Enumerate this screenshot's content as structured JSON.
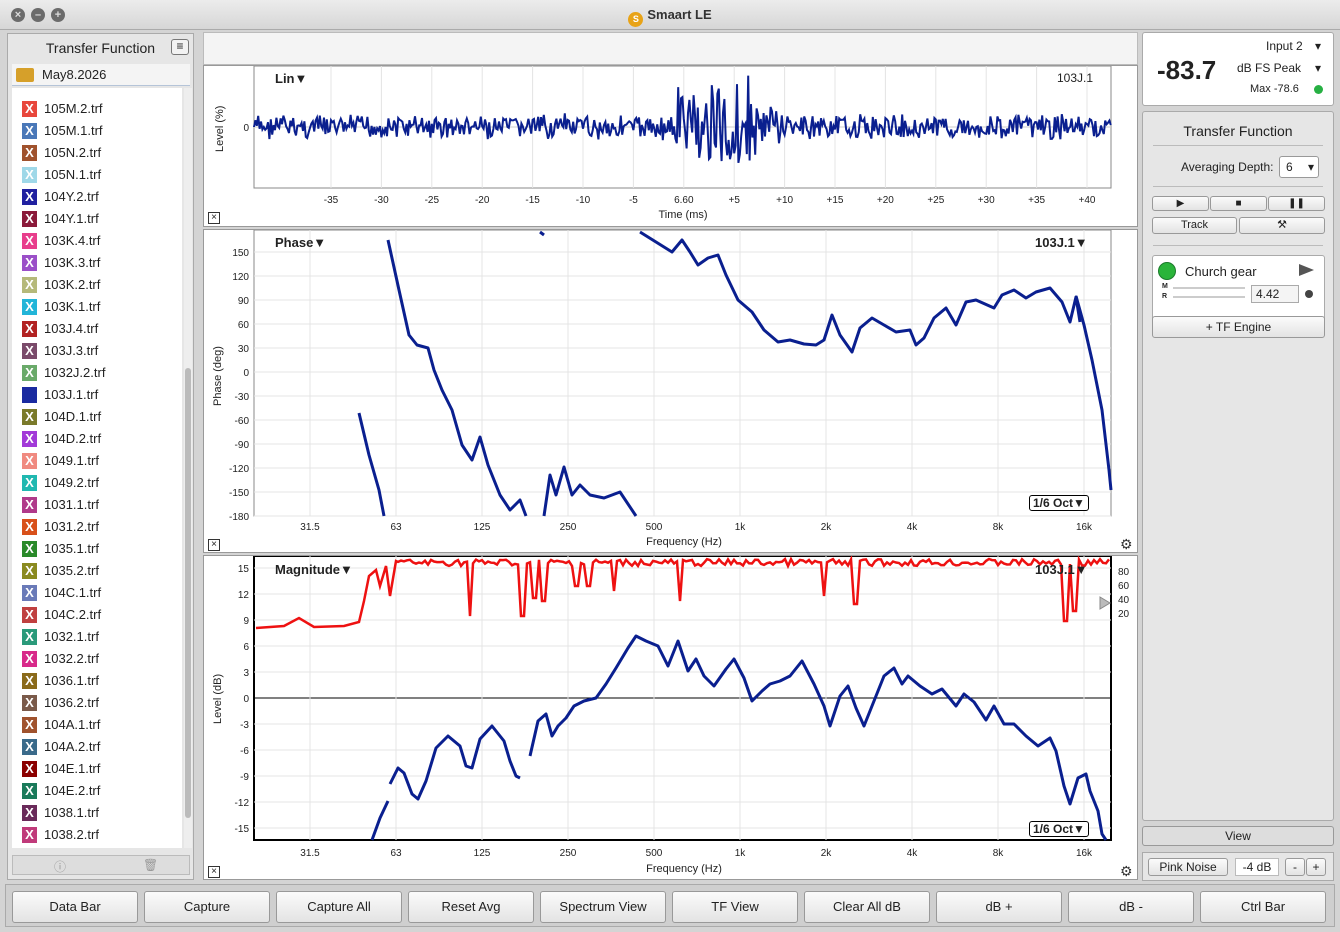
{
  "window": {
    "title": "Smaart LE"
  },
  "left": {
    "title": "Transfer Function",
    "folder": "May8.2026",
    "files": [
      {
        "name": "105M.2.trf",
        "color": "#e8473c"
      },
      {
        "name": "105M.1.trf",
        "color": "#4a78b8"
      },
      {
        "name": "105N.2.trf",
        "color": "#a0522d"
      },
      {
        "name": "105N.1.trf",
        "color": "#9fd8e8"
      },
      {
        "name": "104Y.2.trf",
        "color": "#2020a0"
      },
      {
        "name": "104Y.1.trf",
        "color": "#8b1a3a"
      },
      {
        "name": "103K.4.trf",
        "color": "#e83e8c"
      },
      {
        "name": "103K.3.trf",
        "color": "#9b4fc8"
      },
      {
        "name": "103K.2.trf",
        "color": "#b5b97a"
      },
      {
        "name": "103K.1.trf",
        "color": "#22b5d8"
      },
      {
        "name": "103J.4.trf",
        "color": "#b22222"
      },
      {
        "name": "103J.3.trf",
        "color": "#7a4a6a"
      },
      {
        "name": "1032J.2.trf",
        "color": "#6aaa6a"
      },
      {
        "name": "103J.1.trf",
        "color": "#1a2aa0",
        "plain": true
      },
      {
        "name": "104D.1.trf",
        "color": "#7a7a2a"
      },
      {
        "name": "104D.2.trf",
        "color": "#a23ad8"
      },
      {
        "name": "1049.1.trf",
        "color": "#f08a80"
      },
      {
        "name": "1049.2.trf",
        "color": "#20b8b0"
      },
      {
        "name": "1031.1.trf",
        "color": "#b03a8a"
      },
      {
        "name": "1031.2.trf",
        "color": "#d8501a"
      },
      {
        "name": "1035.1.trf",
        "color": "#2a8a2a"
      },
      {
        "name": "1035.2.trf",
        "color": "#8a8a20"
      },
      {
        "name": "104C.1.trf",
        "color": "#6a7ab8"
      },
      {
        "name": "104C.2.trf",
        "color": "#c04040"
      },
      {
        "name": "1032.1.trf",
        "color": "#2a9a7a"
      },
      {
        "name": "1032.2.trf",
        "color": "#d82a8a"
      },
      {
        "name": "1036.1.trf",
        "color": "#8a6a1a"
      },
      {
        "name": "1036.2.trf",
        "color": "#7a5a4a"
      },
      {
        "name": "104A.1.trf",
        "color": "#a0522d"
      },
      {
        "name": "104A.2.trf",
        "color": "#3a6a8a"
      },
      {
        "name": "104E.1.trf",
        "color": "#8b0000"
      },
      {
        "name": "104E.2.trf",
        "color": "#1a7a5a"
      },
      {
        "name": "1038.1.trf",
        "color": "#6a2a5a"
      },
      {
        "name": "1038.2.trf",
        "color": "#c03a7a"
      }
    ]
  },
  "impulse": {
    "title": "Lin▼",
    "ref": "103J.1",
    "ylabel": "Level (%)",
    "xlabel": "Time (ms)",
    "yticks": [
      "0"
    ],
    "xticks": [
      "-35",
      "-30",
      "-25",
      "-20",
      "-15",
      "-10",
      "-5",
      "6.60",
      "+5",
      "+10",
      "+15",
      "+20",
      "+25",
      "+30",
      "+35",
      "+40"
    ]
  },
  "phase": {
    "title": "Phase▼",
    "ref": "103J.1▼",
    "ylabel": "Phase (deg)",
    "xlabel": "Frequency (Hz)",
    "yticks": [
      "150",
      "120",
      "90",
      "60",
      "30",
      "0",
      "-30",
      "-60",
      "-90",
      "-120",
      "-150",
      "-180"
    ],
    "xticks": [
      "31.5",
      "63",
      "125",
      "250",
      "500",
      "1k",
      "2k",
      "4k",
      "8k",
      "16k"
    ],
    "smoothing": "1/6 Oct▼"
  },
  "magnitude": {
    "title": "Magnitude▼",
    "ref": "103J.1▼",
    "ylabel": "Level (dB)",
    "xlabel": "Frequency (Hz)",
    "yticks": [
      "15",
      "12",
      "9",
      "6",
      "3",
      "0",
      "-3",
      "-6",
      "-9",
      "-12",
      "-15"
    ],
    "xticks": [
      "31.5",
      "63",
      "125",
      "250",
      "500",
      "1k",
      "2k",
      "4k",
      "8k",
      "16k"
    ],
    "coh_ticks": [
      "80",
      "60",
      "40",
      "20"
    ],
    "smoothing": "1/6 Oct▼"
  },
  "meter": {
    "input": "Input 2",
    "value": "-83.7",
    "unit": "dB FS Peak",
    "max": "Max -78.6",
    "status_color": "#27b043"
  },
  "tf": {
    "title": "Transfer Function",
    "avg_label": "Averaging Depth:",
    "avg_value": "6",
    "track": "Track",
    "measurement": "Church gear",
    "delay": "4.42",
    "m": "M",
    "r": "R",
    "add_engine": "+ TF Engine",
    "view": "View",
    "pink": "Pink Noise",
    "pink_level": "-4 dB",
    "minus": "-",
    "plus": "+"
  },
  "bottom": [
    "Data Bar",
    "Capture",
    "Capture All",
    "Reset Avg",
    "Spectrum View",
    "TF View",
    "Clear All dB",
    "dB +",
    "dB -",
    "Ctrl Bar"
  ],
  "colors": {
    "trace_blue": "#0a1f8f",
    "coh_red": "#ee1111"
  }
}
